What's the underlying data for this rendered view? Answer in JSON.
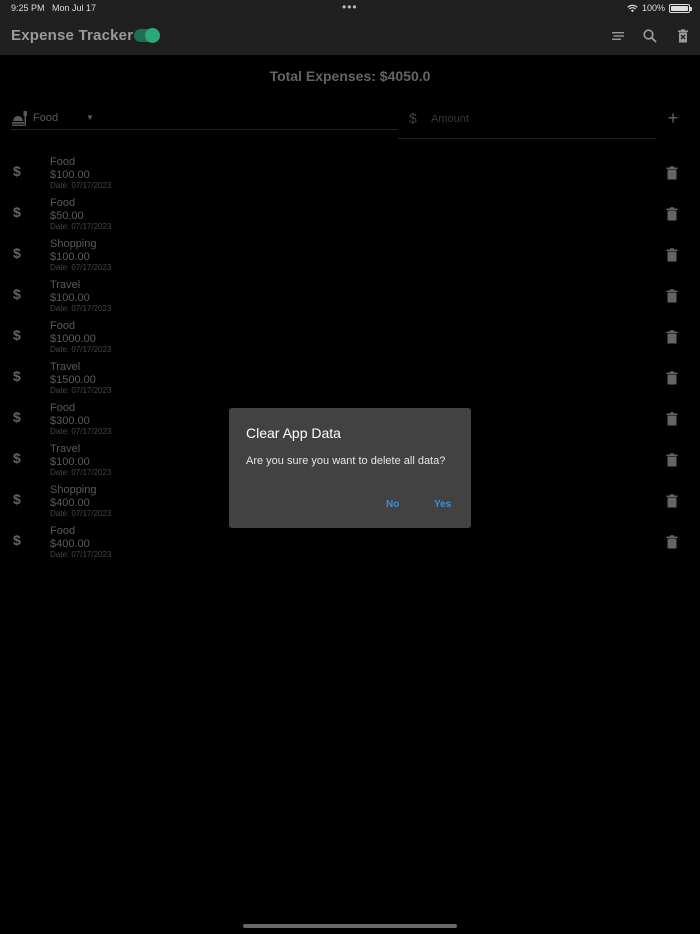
{
  "status_bar": {
    "time": "9:25 PM",
    "date": "Mon Jul 17",
    "dots": "•••",
    "battery_percent": 100,
    "battery_label": "100%"
  },
  "app_bar": {
    "title": "Expense Tracker",
    "toggle_on": true,
    "accent_color": "#2aa879",
    "icons": [
      "sort-icon",
      "search-icon",
      "delete-all-icon"
    ]
  },
  "summary": {
    "total_label": "Total Expenses: $4050.0"
  },
  "form": {
    "category_value": "Food",
    "amount_placeholder": "Amount",
    "currency_symbol": "$",
    "add_label": "+"
  },
  "expenses": [
    {
      "category": "Food",
      "amount": "$100.00",
      "date": "Date: 07/17/2023"
    },
    {
      "category": "Food",
      "amount": "$50.00",
      "date": "Date: 07/17/2023"
    },
    {
      "category": "Shopping",
      "amount": "$100.00",
      "date": "Date: 07/17/2023"
    },
    {
      "category": "Travel",
      "amount": "$100.00",
      "date": "Date: 07/17/2023"
    },
    {
      "category": "Food",
      "amount": "$1000.00",
      "date": "Date: 07/17/2023"
    },
    {
      "category": "Travel",
      "amount": "$1500.00",
      "date": "Date: 07/17/2023"
    },
    {
      "category": "Food",
      "amount": "$300.00",
      "date": "Date: 07/17/2023"
    },
    {
      "category": "Travel",
      "amount": "$100.00",
      "date": "Date: 07/17/2023"
    },
    {
      "category": "Shopping",
      "amount": "$400.00",
      "date": "Date: 07/17/2023"
    },
    {
      "category": "Food",
      "amount": "$400.00",
      "date": "Date: 07/17/2023"
    }
  ],
  "dialog": {
    "title": "Clear App Data",
    "message": "Are you sure you want to delete all data?",
    "no_label": "No",
    "yes_label": "Yes",
    "button_color": "#3d8fd9"
  }
}
